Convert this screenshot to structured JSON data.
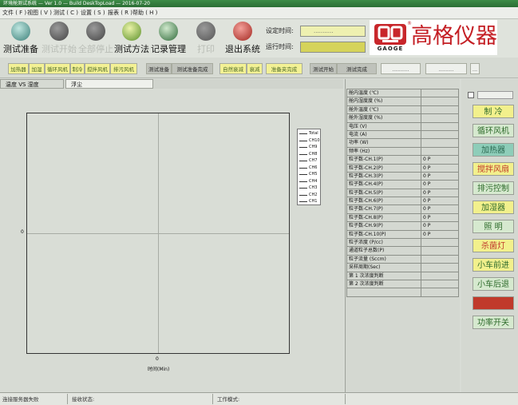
{
  "window": {
    "title": "环境舱测试系统 — Ver 1.0 — Build DeskTopLoad — 2016-07-20"
  },
  "menu": [
    {
      "label": "文件 ( F )"
    },
    {
      "label": "视图 ( V )"
    },
    {
      "label": "测试 ( C )"
    },
    {
      "label": "设置 ( S )"
    },
    {
      "label": "报表 ( R )"
    },
    {
      "label": "帮助 ( H )"
    }
  ],
  "toolbar": {
    "items": [
      {
        "label": "测试准备",
        "icon": "prep-icon",
        "enabled": true
      },
      {
        "label": "测试开始",
        "icon": "start-icon",
        "enabled": false
      },
      {
        "label": "全部停止",
        "icon": "stop-all-icon",
        "enabled": false
      },
      {
        "label": "测试方法",
        "icon": "method-icon",
        "enabled": true
      },
      {
        "label": "记录管理",
        "icon": "record-icon",
        "enabled": true
      },
      {
        "label": "打印",
        "icon": "print-icon",
        "enabled": false
      },
      {
        "label": "退出系统",
        "icon": "exit-icon",
        "enabled": true
      }
    ]
  },
  "timers": {
    "set_label": "设定时间:",
    "set_value": "...........",
    "run_label": "运行时间:",
    "run_value": ""
  },
  "logo": {
    "name": "高格仪器",
    "sub": "GAOGE",
    "mark": "®"
  },
  "strip": {
    "group1": [
      "加热器",
      "加湿",
      "循环风机",
      "制冷",
      "搅拌风机",
      "排污风机"
    ],
    "group2": [
      "测试准备",
      "测试准备完成"
    ],
    "group3": [
      "自然衰减",
      "衰减",
      "准备夹完成"
    ],
    "group4": [
      "测试开始",
      "测试完成"
    ],
    "readouts": [
      "..........",
      ".........",
      "..."
    ]
  },
  "tabs": [
    {
      "label": "温度 VS 湿度",
      "active": false
    },
    {
      "label": "浮尘",
      "active": true
    }
  ],
  "chart_data": {
    "type": "line",
    "xlabel": "时间(Min)",
    "ylabel": "",
    "x_tick": "0",
    "y_tick": "0",
    "legend_position": "top-right",
    "grid": true,
    "series": [
      {
        "name": "Total",
        "values": []
      },
      {
        "name": "CH10",
        "values": []
      },
      {
        "name": "CH9",
        "values": []
      },
      {
        "name": "CH8",
        "values": []
      },
      {
        "name": "CH7",
        "values": []
      },
      {
        "name": "CH6",
        "values": []
      },
      {
        "name": "CH5",
        "values": []
      },
      {
        "name": "CH4",
        "values": []
      },
      {
        "name": "CH3",
        "values": []
      },
      {
        "name": "CH2",
        "values": []
      },
      {
        "name": "CH1",
        "values": []
      }
    ]
  },
  "data_table": [
    {
      "label": "舱内温度 (℃)",
      "value": ""
    },
    {
      "label": "舱内湿度度 (%)",
      "value": ""
    },
    {
      "label": "舱外温度 (℃)",
      "value": ""
    },
    {
      "label": "舱外湿度度 (%)",
      "value": ""
    },
    {
      "label": "电压 (V)",
      "value": ""
    },
    {
      "label": "电流 (A)",
      "value": ""
    },
    {
      "label": "功率 (W)",
      "value": ""
    },
    {
      "label": "频率 (Hz)",
      "value": ""
    },
    {
      "label": "粒子数-CH.1(P)",
      "value": "0 P"
    },
    {
      "label": "粒子数-CH.2(P)",
      "value": "0 P"
    },
    {
      "label": "粒子数-CH.3(P)",
      "value": "0 P"
    },
    {
      "label": "粒子数-CH.4(P)",
      "value": "0 P"
    },
    {
      "label": "粒子数-CH.5(P)",
      "value": "0 P"
    },
    {
      "label": "粒子数-CH.6(P)",
      "value": "0 P"
    },
    {
      "label": "粒子数-CH.7(P)",
      "value": "0 P"
    },
    {
      "label": "粒子数-CH.8(P)",
      "value": "0 P"
    },
    {
      "label": "粒子数-CH.9(P)",
      "value": "0 P"
    },
    {
      "label": "粒子数-CH.10(P)",
      "value": "0 P"
    },
    {
      "label": "粒子浓度 (P/cc)",
      "value": ""
    },
    {
      "label": "通道粒子总数(P)",
      "value": ""
    },
    {
      "label": "粒子流量 (Sccm)",
      "value": ""
    },
    {
      "label": "采样周期(Sec)",
      "value": ""
    },
    {
      "label": "第 1 次浓度判断",
      "value": ""
    },
    {
      "label": "第 2 次浓度判断",
      "value": ""
    },
    {
      "label": "",
      "value": ""
    }
  ],
  "controls": [
    {
      "label": "制  冷",
      "style": "y"
    },
    {
      "label": "循环风机",
      "style": "gr"
    },
    {
      "label": "加热器",
      "style": "teal"
    },
    {
      "label": "搅拌风扇",
      "style": "yr"
    },
    {
      "label": "排污控制",
      "style": "gr"
    },
    {
      "label": "加湿器",
      "style": "y"
    },
    {
      "label": "照  明",
      "style": "gr"
    },
    {
      "label": "杀菌灯",
      "style": "yr"
    },
    {
      "label": "小车前进",
      "style": "y"
    },
    {
      "label": "小车后退",
      "style": "gr"
    },
    {
      "label": "",
      "style": "red"
    },
    {
      "label": "功率开关",
      "style": "gr"
    }
  ],
  "statusbar": {
    "conn": "连接服务器失败",
    "recv": "接收状态:",
    "mode": "工作模式:"
  },
  "colors": {
    "accent_red": "#c41e24",
    "pill_yellow": "#f3f195",
    "title_green": "#2b6e34"
  }
}
